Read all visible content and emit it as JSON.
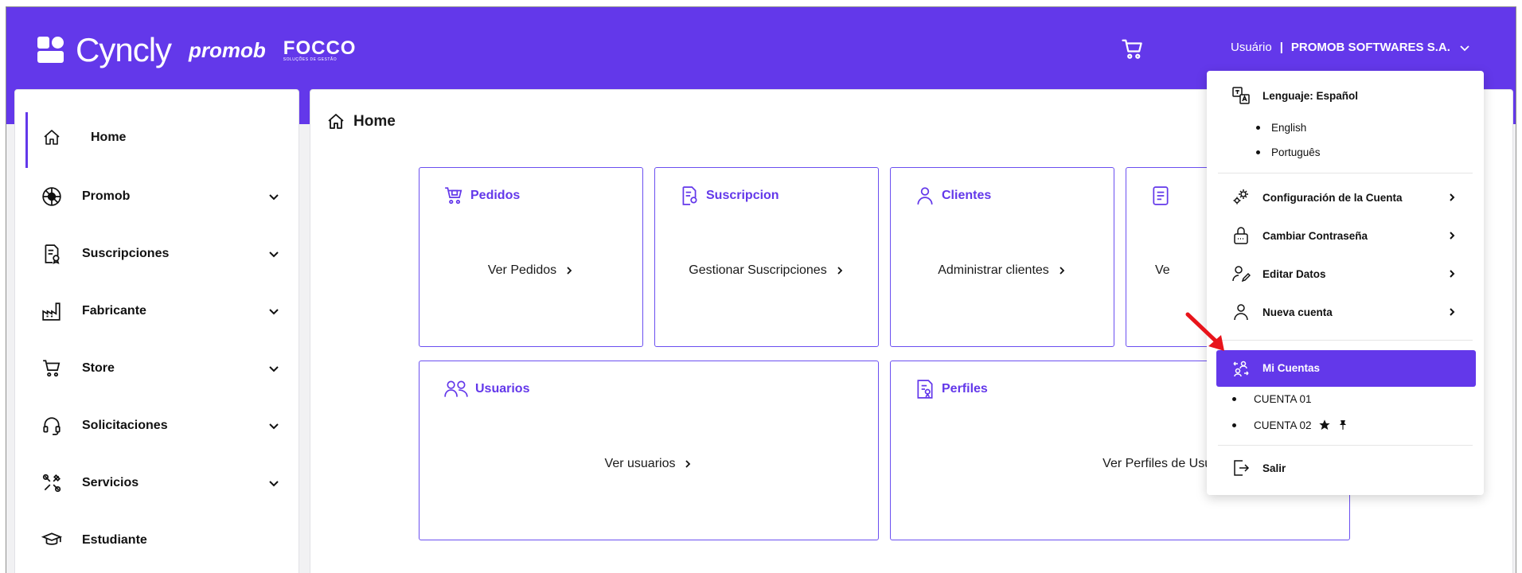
{
  "header": {
    "brand": "Cyncly",
    "partner_1": "promob",
    "partner_2": "FOCCO",
    "partner_2_tag": "SOLUÇÕES DE GESTÃO",
    "user_label": "Usuário",
    "separator": "|",
    "company": "PROMOB SOFTWARES S.A."
  },
  "sidebar": {
    "items": [
      {
        "label": "Home",
        "icon": "home-icon",
        "expandable": false,
        "active": true
      },
      {
        "label": "Promob",
        "icon": "promob-icon",
        "expandable": true
      },
      {
        "label": "Suscripciones",
        "icon": "subscription-icon",
        "expandable": true
      },
      {
        "label": "Fabricante",
        "icon": "factory-icon",
        "expandable": true
      },
      {
        "label": "Store",
        "icon": "cart-icon",
        "expandable": true
      },
      {
        "label": "Solicitaciones",
        "icon": "headset-icon",
        "expandable": true
      },
      {
        "label": "Servicios",
        "icon": "tools-icon",
        "expandable": true
      },
      {
        "label": "Estudiante",
        "icon": "graduation-cap-icon",
        "expandable": false
      }
    ]
  },
  "main": {
    "breadcrumb": "Home",
    "cards": [
      {
        "title": "Pedidos",
        "link": "Ver Pedidos"
      },
      {
        "title": "Suscripcion",
        "link": "Gestionar Suscripciones"
      },
      {
        "title": "Clientes",
        "link": "Administrar clientes"
      },
      {
        "title": "",
        "link": "Ve"
      },
      {
        "title": "Usuarios",
        "link": "Ver usuarios"
      },
      {
        "title": "Perfiles",
        "link": "Ver Perfiles de Usuario"
      }
    ]
  },
  "dropdown": {
    "language_label": "Lenguaje: Español",
    "languages": [
      "English",
      "Português"
    ],
    "items": [
      {
        "label": "Configuración de la Cuenta",
        "icon": "gears-icon"
      },
      {
        "label": "Cambiar Contraseña",
        "icon": "lock-icon"
      },
      {
        "label": "Editar Datos",
        "icon": "edit-user-icon"
      },
      {
        "label": "Nueva cuenta",
        "icon": "user-icon"
      }
    ],
    "accounts_label": "Mi Cuentas",
    "accounts": [
      "CUENTA 01",
      "CUENTA 02"
    ],
    "logout_label": "Salir"
  },
  "colors": {
    "accent": "#6338ea",
    "annotation_arrow": "#e8141b"
  }
}
